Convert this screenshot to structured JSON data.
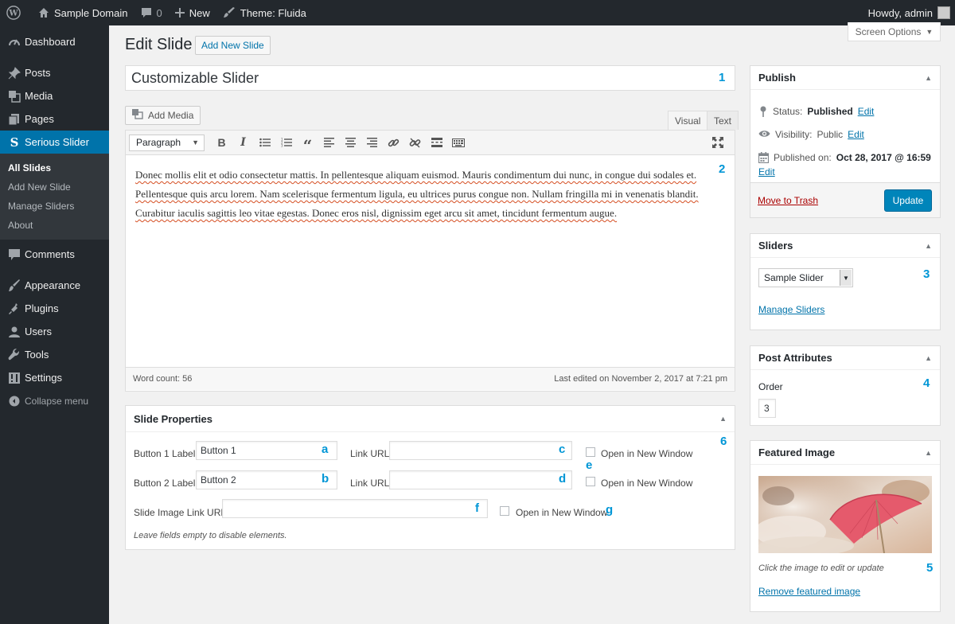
{
  "adminbar": {
    "site_name": "Sample Domain",
    "comments_count": "0",
    "new_label": "New",
    "theme_label": "Theme: Fluida",
    "howdy": "Howdy, admin"
  },
  "sidebar": {
    "items": [
      {
        "label": "Dashboard",
        "icon": "dashboard-icon"
      },
      {
        "label": "Posts",
        "icon": "pin-icon"
      },
      {
        "label": "Media",
        "icon": "media-icon"
      },
      {
        "label": "Pages",
        "icon": "pages-icon"
      },
      {
        "label": "Serious Slider",
        "icon": "serious-slider-icon"
      },
      {
        "label": "Comments",
        "icon": "comment-icon"
      },
      {
        "label": "Appearance",
        "icon": "brush-icon"
      },
      {
        "label": "Plugins",
        "icon": "plug-icon"
      },
      {
        "label": "Users",
        "icon": "user-icon"
      },
      {
        "label": "Tools",
        "icon": "wrench-icon"
      },
      {
        "label": "Settings",
        "icon": "settings-icon"
      },
      {
        "label": "Collapse menu",
        "icon": "collapse-icon"
      }
    ],
    "submenu": [
      "All Slides",
      "Add New Slide",
      "Manage Sliders",
      "About"
    ]
  },
  "header": {
    "title": "Edit Slide",
    "add_new": "Add New Slide",
    "screen_options": "Screen Options"
  },
  "post": {
    "title": "Customizable Slider",
    "add_media": "Add Media",
    "tab_visual": "Visual",
    "tab_text": "Text",
    "format": "Paragraph",
    "content": [
      "Donec mollis elit et odio consectetur mattis. In pellentesque aliquam euismod. Mauris condimentum dui nunc, in congue dui sodales et.",
      "Pellentesque quis arcu lorem. Nam scelerisque fermentum ligula, eu ultrices purus congue non. Nullam fringilla mi in venenatis blandit.",
      "Curabitur iaculis sagittis leo vitae egestas. Donec eros nisl, dignissim eget arcu sit amet, tincidunt fermentum augue."
    ],
    "word_count": "Word count: 56",
    "last_edited": "Last edited on November 2, 2017 at 7:21 pm"
  },
  "slide_properties": {
    "title": "Slide Properties",
    "button1_label": "Button 1 Label:",
    "button1_value": "Button 1",
    "button2_label": "Button 2 Label:",
    "button2_value": "Button 2",
    "link_url_label": "Link URL:",
    "open_new_window": "Open in New Window",
    "slide_image_link_label": "Slide Image Link URL:",
    "note": "Leave fields empty to disable elements."
  },
  "publish": {
    "title": "Publish",
    "status_label": "Status:",
    "status_value": "Published",
    "visibility_label": "Visibility:",
    "visibility_value": "Public",
    "published_on_label": "Published on:",
    "published_on_value": "Oct 28, 2017 @ 16:59",
    "edit": "Edit",
    "trash": "Move to Trash",
    "update": "Update"
  },
  "sliders_box": {
    "title": "Sliders",
    "selected": "Sample Slider",
    "manage": "Manage Sliders"
  },
  "attributes_box": {
    "title": "Post Attributes",
    "order_label": "Order",
    "order_value": "3"
  },
  "featured_box": {
    "title": "Featured Image",
    "hint": "Click the image to edit or update",
    "remove": "Remove featured image"
  },
  "annotations": {
    "n1": "1",
    "n2": "2",
    "n3": "3",
    "n4": "4",
    "n5": "5",
    "n6": "6",
    "a": "a",
    "b": "b",
    "c": "c",
    "d": "d",
    "e": "e",
    "f": "f",
    "g": "g"
  },
  "colors": {
    "adminbar": "#23282d",
    "accent": "#0073aa",
    "primary_button": "#0085ba",
    "annotation": "#0096d6"
  }
}
